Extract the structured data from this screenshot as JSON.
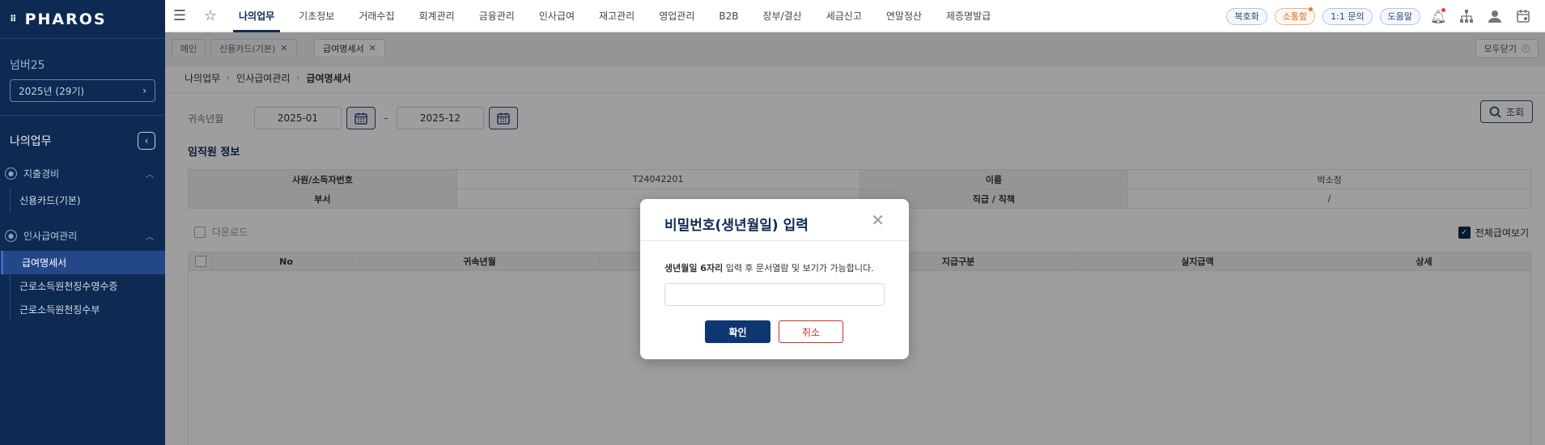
{
  "brand": {
    "logo": "PHAROS"
  },
  "sidebar": {
    "corp_name": "넘버25",
    "year_select": "2025년 (29기)",
    "menu_title": "나의업무",
    "groups": [
      {
        "label": "지출경비",
        "items": [
          "신용카드(기본)"
        ]
      },
      {
        "label": "인사급여관리",
        "items": [
          "급여명세서",
          "근로소득원천징수영수증",
          "근로소득원천징수부"
        ]
      }
    ]
  },
  "topnav": {
    "items": [
      "나의업무",
      "기초정보",
      "거래수집",
      "회계관리",
      "금융관리",
      "인사급여",
      "재고관리",
      "영업관리",
      "B2B",
      "장부/결산",
      "세금신고",
      "연말정산",
      "제증명발급"
    ],
    "active": "나의업무",
    "pills": [
      "복호화",
      "소통함",
      "1:1 문의",
      "도움말"
    ]
  },
  "tabs": {
    "items": [
      "메인",
      "신용카드(기본)",
      "급여명세서"
    ],
    "close_all": "모두닫기"
  },
  "breadcrumb": [
    "나의업무",
    "인사급여관리",
    "급여명세서"
  ],
  "filter": {
    "label": "귀속년월",
    "from": "2025-01",
    "to": "2025-12",
    "search_label": "조회"
  },
  "employee": {
    "section_title": "임직원 정보",
    "row1": {
      "h1": "사원/소득자번호",
      "v1": "T24042201",
      "h2": "이름",
      "v2": "박소정"
    },
    "row2": {
      "h1": "부서",
      "v1": "",
      "h2": "직급 / 직책",
      "v2": "/"
    }
  },
  "toolbar": {
    "download": "다운로드",
    "show_all": "전체급여보기"
  },
  "grid": {
    "columns": [
      "No",
      "귀속년월",
      "",
      "지급구분",
      "실지급액",
      "상세"
    ]
  },
  "modal": {
    "title": "비밀번호(생년월일) 입력",
    "desc_bold": "생년월일 6자리",
    "desc_rest": " 입력 후 문서열람 및 보기가 가능합니다.",
    "ok": "확인",
    "cancel": "취소"
  }
}
